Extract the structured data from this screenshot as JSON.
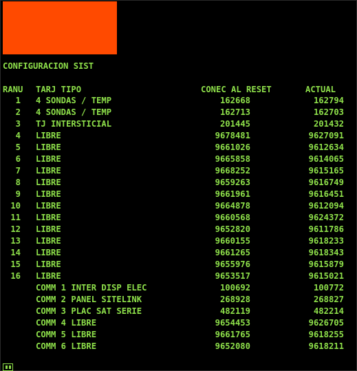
{
  "screen": {
    "title": "CONFIGURACION SIST",
    "accent_color": "#ff4a00",
    "text_color": "#8ee04a",
    "background_color": "#000000"
  },
  "table": {
    "headers": {
      "ranu": "RANU",
      "tipo": "TARJ TIPO",
      "conec": "CONEC AL RESET",
      "actual": "ACTUAL"
    },
    "rows": [
      {
        "ranu": "1",
        "tipo": "4 SONDAS / TEMP",
        "conec": "162668",
        "actual": "162794"
      },
      {
        "ranu": "2",
        "tipo": "4 SONDAS / TEMP",
        "conec": "162713",
        "actual": "162703"
      },
      {
        "ranu": "3",
        "tipo": "TJ INTERSTICIAL",
        "conec": "201445",
        "actual": "201432"
      },
      {
        "ranu": "4",
        "tipo": "LIBRE",
        "conec": "9678481",
        "actual": "9627091"
      },
      {
        "ranu": "5",
        "tipo": "LIBRE",
        "conec": "9661026",
        "actual": "9612634"
      },
      {
        "ranu": "6",
        "tipo": "LIBRE",
        "conec": "9665858",
        "actual": "9614065"
      },
      {
        "ranu": "7",
        "tipo": "LIBRE",
        "conec": "9668252",
        "actual": "9615165"
      },
      {
        "ranu": "8",
        "tipo": "LIBRE",
        "conec": "9659263",
        "actual": "9616749"
      },
      {
        "ranu": "9",
        "tipo": "LIBRE",
        "conec": "9661961",
        "actual": "9616451"
      },
      {
        "ranu": "10",
        "tipo": "LIBRE",
        "conec": "9664878",
        "actual": "9612094"
      },
      {
        "ranu": "11",
        "tipo": "LIBRE",
        "conec": "9660568",
        "actual": "9624372"
      },
      {
        "ranu": "12",
        "tipo": "LIBRE",
        "conec": "9652820",
        "actual": "9611786"
      },
      {
        "ranu": "13",
        "tipo": "LIBRE",
        "conec": "9660155",
        "actual": "9618233"
      },
      {
        "ranu": "14",
        "tipo": "LIBRE",
        "conec": "9661265",
        "actual": "9618343"
      },
      {
        "ranu": "15",
        "tipo": "LIBRE",
        "conec": "9655976",
        "actual": "9615879"
      },
      {
        "ranu": "16",
        "tipo": "LIBRE",
        "conec": "9653517",
        "actual": "9615021"
      },
      {
        "ranu": "",
        "tipo": "COMM 1 INTER DISP ELEC",
        "conec": "100692",
        "actual": "100772"
      },
      {
        "ranu": "",
        "tipo": "COMM 2 PANEL SITELINK",
        "conec": "268928",
        "actual": "268827"
      },
      {
        "ranu": "",
        "tipo": "COMM 3 PLAC SAT SERIE",
        "conec": "482119",
        "actual": "482214"
      },
      {
        "ranu": "",
        "tipo": "COMM 4 LIBRE",
        "conec": "9654453",
        "actual": "9626705"
      },
      {
        "ranu": "",
        "tipo": "COMM 5 LIBRE",
        "conec": "9661765",
        "actual": "9618255"
      },
      {
        "ranu": "",
        "tipo": "COMM 6 LIBRE",
        "conec": "9652080",
        "actual": "9618211"
      }
    ]
  },
  "status_icon": "terminal-status-icon"
}
